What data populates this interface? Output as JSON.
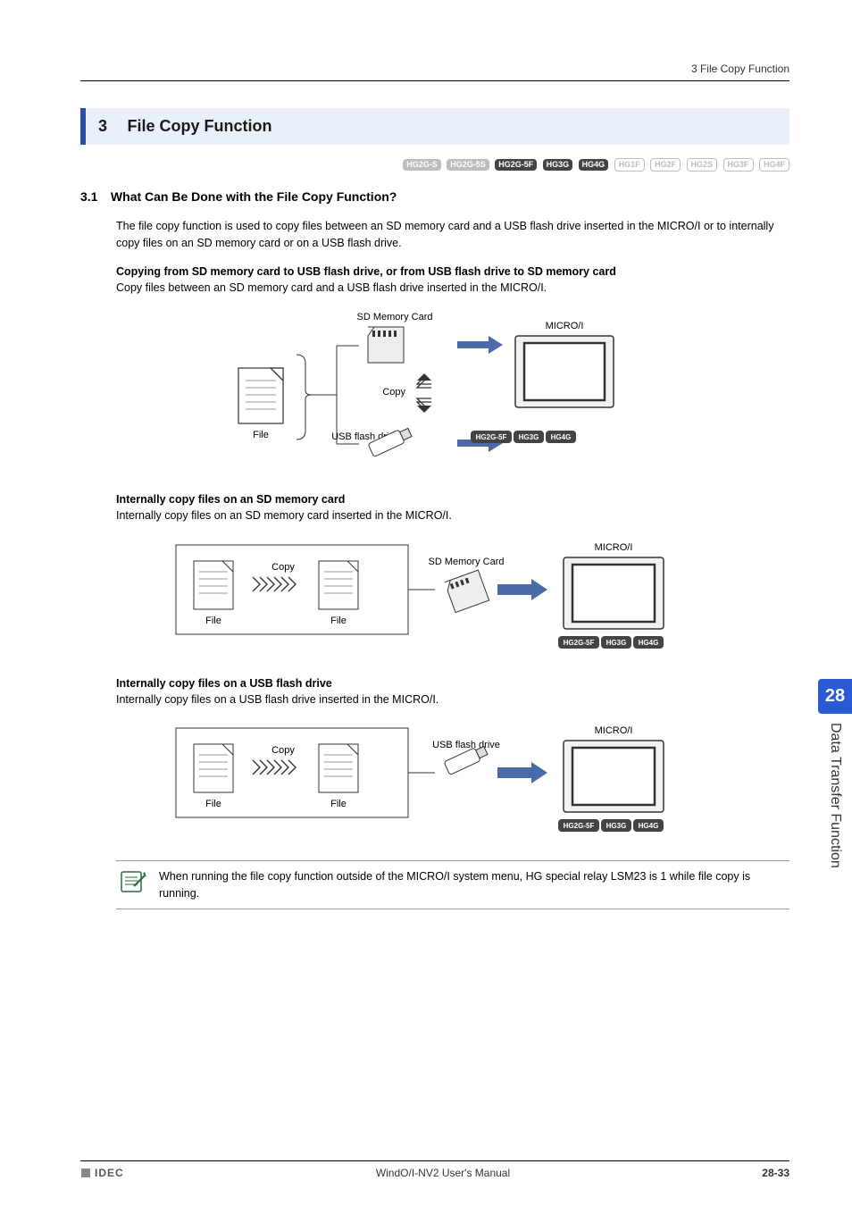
{
  "header": {
    "breadcrumb": "3 File Copy Function"
  },
  "section": {
    "number": "3",
    "title": "File Copy Function"
  },
  "badges": {
    "row1": [
      {
        "label": "HG2G-S",
        "cls": "grey-fill"
      },
      {
        "label": "HG2G-5S",
        "cls": "grey-fill"
      },
      {
        "label": "HG2G-5F",
        "cls": "dark-fill"
      },
      {
        "label": "HG3G",
        "cls": "dark-fill"
      },
      {
        "label": "HG4G",
        "cls": "dark-fill"
      },
      {
        "label": "HG1F",
        "cls": "grey-out"
      },
      {
        "label": "HG2F",
        "cls": "grey-out"
      },
      {
        "label": "HG2S",
        "cls": "grey-out"
      },
      {
        "label": "HG3F",
        "cls": "grey-out"
      },
      {
        "label": "HG4F",
        "cls": "grey-out"
      }
    ],
    "mini": [
      {
        "label": "HG2G-5F",
        "cls": "dark-fill"
      },
      {
        "label": "HG3G",
        "cls": "dark-fill"
      },
      {
        "label": "HG4G",
        "cls": "dark-fill"
      }
    ]
  },
  "sub31": {
    "number": "3.1",
    "heading": "What Can Be Done with the File Copy Function?"
  },
  "intro": "The file copy function is used to copy files between an SD memory card and a USB flash drive inserted in the MICRO/I or to internally copy files on an SD memory card or on a USB flash drive.",
  "h1": "Copying from SD memory card to USB flash drive, or from USB flash drive to SD memory card",
  "p1": "Copy files between an SD memory card and a USB flash drive inserted in the MICRO/I.",
  "d1": {
    "file": "File",
    "sd": "SD Memory Card",
    "copy": "Copy",
    "usb": "USB flash drive",
    "micro": "MICRO/I"
  },
  "h2": "Internally copy files on an SD memory card",
  "p2": "Internally copy files on an SD memory card inserted in the MICRO/I.",
  "d2": {
    "file1": "File",
    "file2": "File",
    "copy": "Copy",
    "sd": "SD Memory Card",
    "micro": "MICRO/I"
  },
  "h3": "Internally copy files on a USB flash drive",
  "p3": "Internally copy files on a USB flash drive inserted in the MICRO/I.",
  "d3": {
    "file1": "File",
    "file2": "File",
    "copy": "Copy",
    "usb": "USB flash drive",
    "micro": "MICRO/I"
  },
  "note": "When running the file copy function outside of the MICRO/I system menu, HG special relay LSM23 is 1 while file copy is running.",
  "sideTab": {
    "num": "28",
    "label": "Data Transfer Function"
  },
  "footer": {
    "brand": "IDEC",
    "center": "WindO/I-NV2 User's Manual",
    "right": "28-33"
  }
}
